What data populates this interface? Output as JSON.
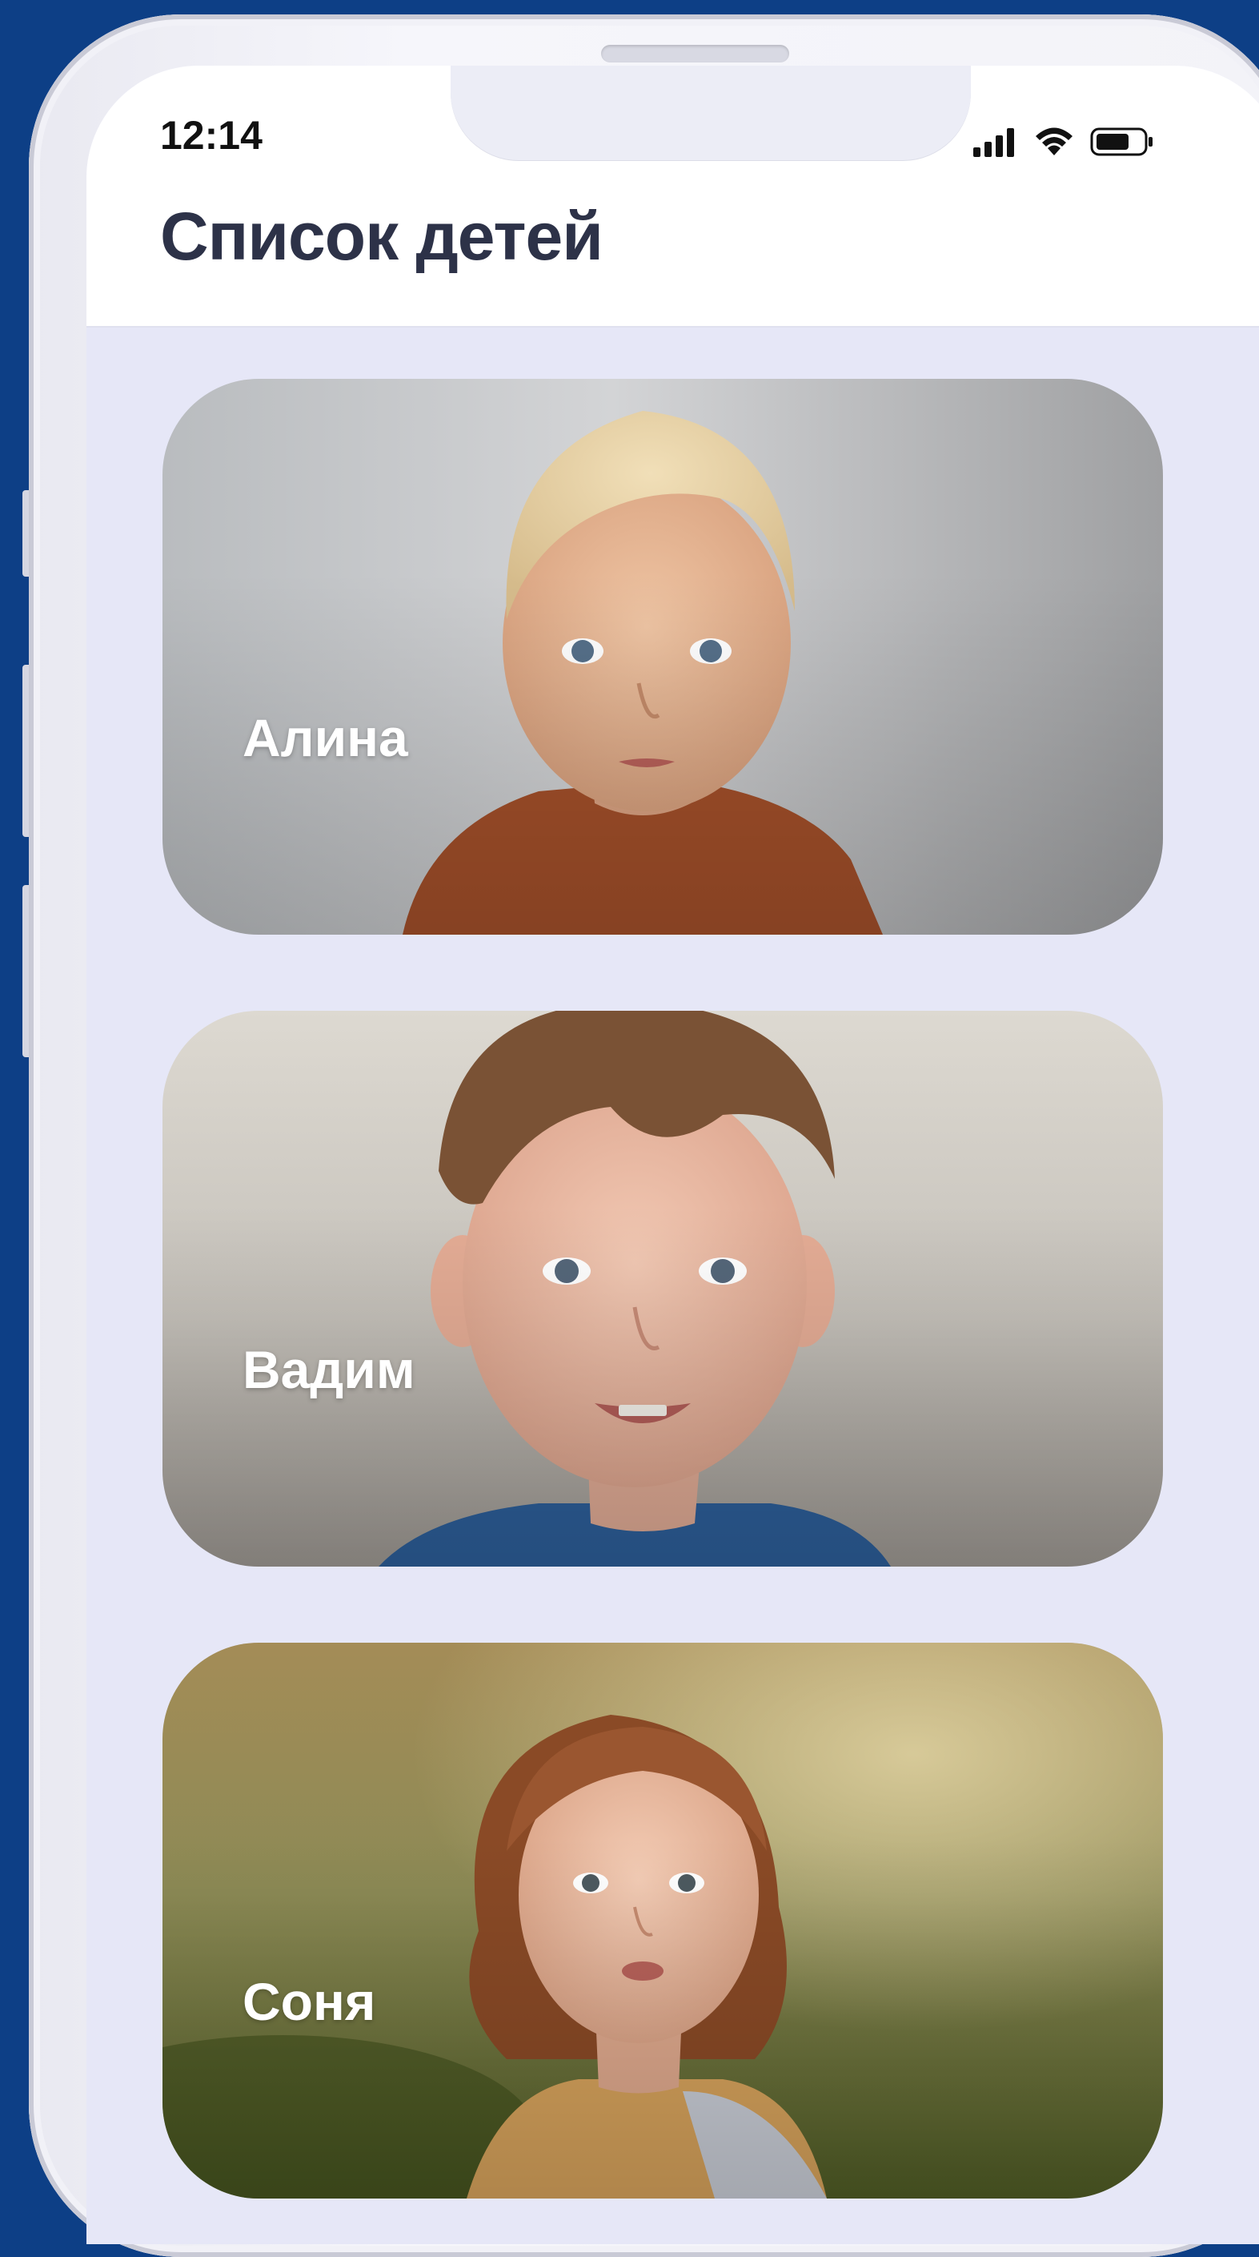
{
  "status_bar": {
    "time": "12:14",
    "signal_icon": "cellular-signal-icon",
    "wifi_icon": "wifi-icon",
    "battery_icon": "battery-icon"
  },
  "header": {
    "title": "Список детей"
  },
  "children": [
    {
      "name": "Алина",
      "photo": "child-photo-girl-blonde",
      "chevron_icon": "chevron-right-icon"
    },
    {
      "name": "Вадим",
      "photo": "child-photo-boy",
      "chevron_icon": "chevron-right-icon"
    },
    {
      "name": "Соня",
      "photo": "child-photo-girl-outdoor",
      "chevron_icon": "chevron-right-icon"
    }
  ],
  "colors": {
    "background": "#0d3f86",
    "screen_background": "#e6e7f7",
    "title": "#2d3248",
    "card_text": "#ffffff"
  }
}
